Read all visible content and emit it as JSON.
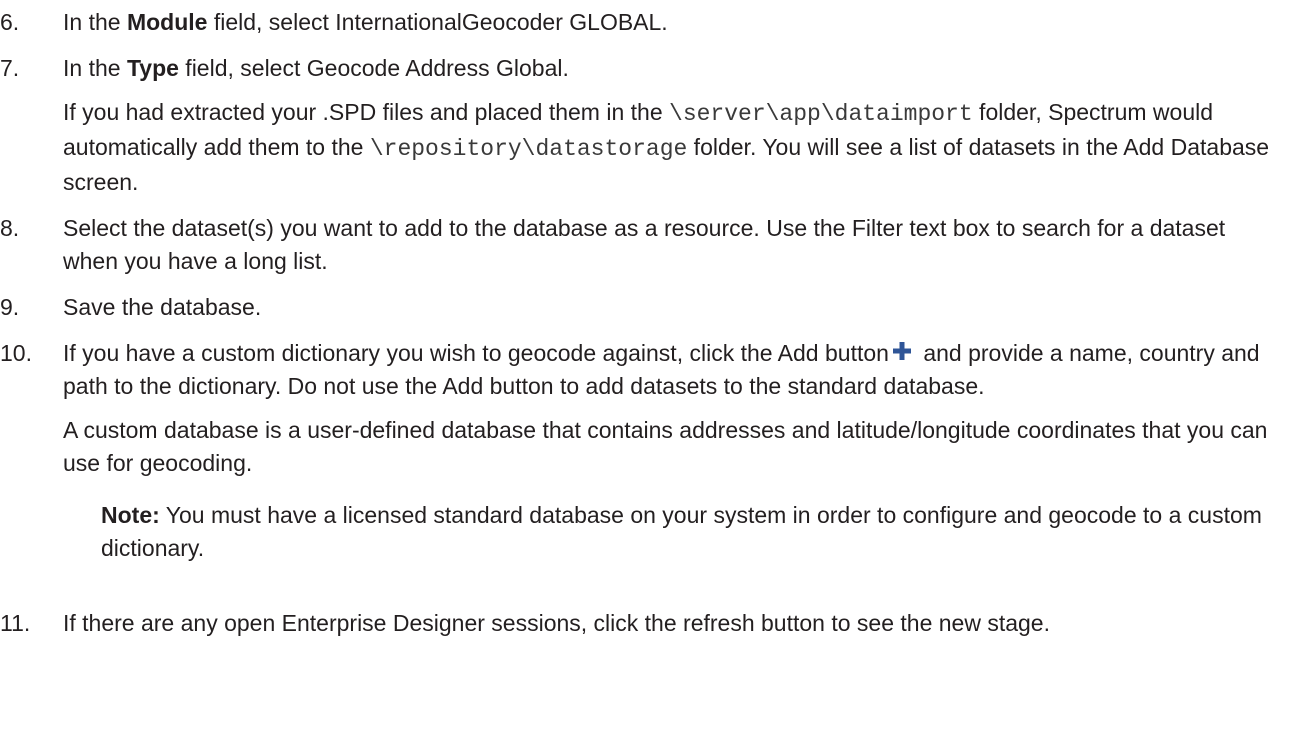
{
  "steps": [
    {
      "num": "6.",
      "pre": "In the ",
      "bold": "Module",
      "post": " field, select InternationalGeocoder GLOBAL."
    },
    {
      "num": "7.",
      "pre": "In the ",
      "bold": "Type",
      "post": " field, select Geocode Address Global.",
      "para": {
        "t1": "If you had extracted your .SPD files and placed them in the ",
        "code1": "\\server\\app\\dataimport",
        "t2": " folder, Spectrum would automatically add them to the ",
        "code2": "\\repository\\datastorage",
        "t3": " folder. You will see a list of datasets in the Add Database screen."
      }
    },
    {
      "num": "8.",
      "text": "Select the dataset(s) you want to add to the database as a resource. Use the Filter text box to search for a dataset when you have a long list."
    },
    {
      "num": "9.",
      "text": "Save the database."
    },
    {
      "num": "10.",
      "t1": "If you have a custom dictionary you wish to geocode against, click the Add button",
      "t2": " and provide a name, country and path to the dictionary. Do not use the Add button to add datasets to the standard database.",
      "para": "A custom database is a user-defined database that contains addresses and latitude/longitude coordinates that you can use for geocoding.",
      "note_label": "Note:",
      "note_text": " You must have a licensed standard database on your system in order to configure and geocode to a custom dictionary."
    },
    {
      "num": "11.",
      "text": "If there are any open Enterprise Designer sessions, click the refresh button to see the new stage."
    }
  ],
  "colors": {
    "text": "#231f20",
    "plus_icon": "#2f5597"
  },
  "icons": {
    "add_button": "plus-icon"
  }
}
